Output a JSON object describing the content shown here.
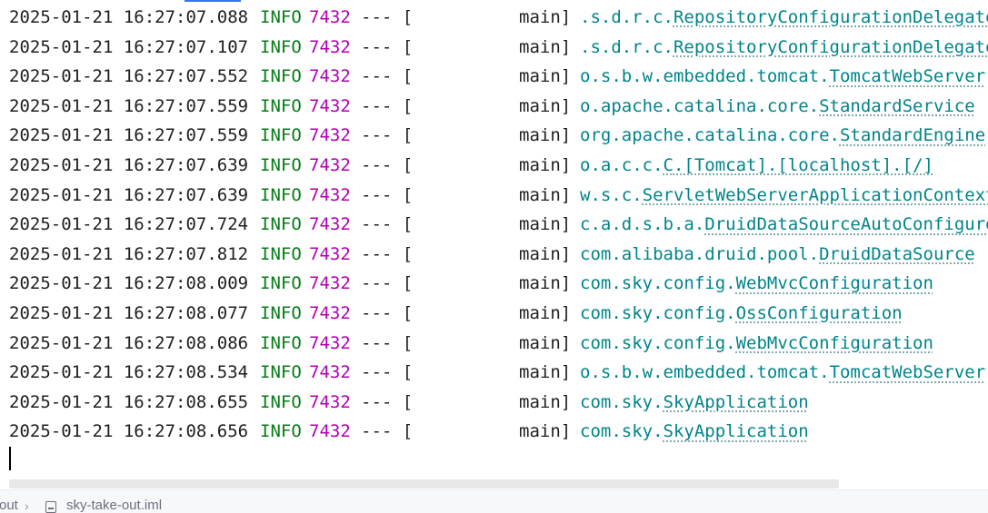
{
  "console": {
    "lines": [
      {
        "timestamp": "2025-01-21 16:27:07.088",
        "level": "INFO",
        "pid": "7432",
        "sep": "--- [",
        "thread": "main]",
        "logger_pkg": ".s.d.r.c.",
        "logger_cls": "RepositoryConfigurationDelegate"
      },
      {
        "timestamp": "2025-01-21 16:27:07.107",
        "level": "INFO",
        "pid": "7432",
        "sep": "--- [",
        "thread": "main]",
        "logger_pkg": ".s.d.r.c.",
        "logger_cls": "RepositoryConfigurationDelegate"
      },
      {
        "timestamp": "2025-01-21 16:27:07.552",
        "level": "INFO",
        "pid": "7432",
        "sep": "--- [",
        "thread": "main]",
        "logger_pkg": "o.s.b.w.embedded.tomcat.",
        "logger_cls": "TomcatWebServer"
      },
      {
        "timestamp": "2025-01-21 16:27:07.559",
        "level": "INFO",
        "pid": "7432",
        "sep": "--- [",
        "thread": "main]",
        "logger_pkg": "o.apache.catalina.core.",
        "logger_cls": "StandardService"
      },
      {
        "timestamp": "2025-01-21 16:27:07.559",
        "level": "INFO",
        "pid": "7432",
        "sep": "--- [",
        "thread": "main]",
        "logger_pkg": "org.apache.catalina.core.",
        "logger_cls": "StandardEngine"
      },
      {
        "timestamp": "2025-01-21 16:27:07.639",
        "level": "INFO",
        "pid": "7432",
        "sep": "--- [",
        "thread": "main]",
        "logger_pkg": "o.a.c.c.",
        "logger_cls": "C",
        "logger_rest": ".[Tomcat].[localhost].[/]"
      },
      {
        "timestamp": "2025-01-21 16:27:07.639",
        "level": "INFO",
        "pid": "7432",
        "sep": "--- [",
        "thread": "main]",
        "logger_pkg": "w.s.c.",
        "logger_cls": "ServletWebServerApplicationContext"
      },
      {
        "timestamp": "2025-01-21 16:27:07.724",
        "level": "INFO",
        "pid": "7432",
        "sep": "--- [",
        "thread": "main]",
        "logger_pkg": "c.a.d.s.b.a.",
        "logger_cls": "DruidDataSourceAutoConfigure"
      },
      {
        "timestamp": "2025-01-21 16:27:07.812",
        "level": "INFO",
        "pid": "7432",
        "sep": "--- [",
        "thread": "main]",
        "logger_pkg": "com.alibaba.druid.pool.",
        "logger_cls": "DruidDataSource"
      },
      {
        "timestamp": "2025-01-21 16:27:08.009",
        "level": "INFO",
        "pid": "7432",
        "sep": "--- [",
        "thread": "main]",
        "logger_pkg": "com.sky.config.",
        "logger_cls": "WebMvcConfiguration"
      },
      {
        "timestamp": "2025-01-21 16:27:08.077",
        "level": "INFO",
        "pid": "7432",
        "sep": "--- [",
        "thread": "main]",
        "logger_pkg": "com.sky.config.",
        "logger_cls": "OssConfiguration"
      },
      {
        "timestamp": "2025-01-21 16:27:08.086",
        "level": "INFO",
        "pid": "7432",
        "sep": "--- [",
        "thread": "main]",
        "logger_pkg": "com.sky.config.",
        "logger_cls": "WebMvcConfiguration"
      },
      {
        "timestamp": "2025-01-21 16:27:08.534",
        "level": "INFO",
        "pid": "7432",
        "sep": "--- [",
        "thread": "main]",
        "logger_pkg": "o.s.b.w.embedded.tomcat.",
        "logger_cls": "TomcatWebServer"
      },
      {
        "timestamp": "2025-01-21 16:27:08.655",
        "level": "INFO",
        "pid": "7432",
        "sep": "--- [",
        "thread": "main]",
        "logger_pkg": "com.sky.",
        "logger_cls": "SkyApplication"
      },
      {
        "timestamp": "2025-01-21 16:27:08.656",
        "level": "INFO",
        "pid": "7432",
        "sep": "--- [",
        "thread": "main]",
        "logger_pkg": "com.sky.",
        "logger_cls": "SkyApplication"
      }
    ]
  },
  "statusbar": {
    "crumb_parent": "out",
    "chevron": "›",
    "file_icon": "iml-file-icon",
    "crumb_file": "sky-take-out.iml"
  },
  "colors": {
    "level_info": "#067d17",
    "pid": "#b200b2",
    "logger": "#00848a",
    "accent": "#3574f0"
  }
}
